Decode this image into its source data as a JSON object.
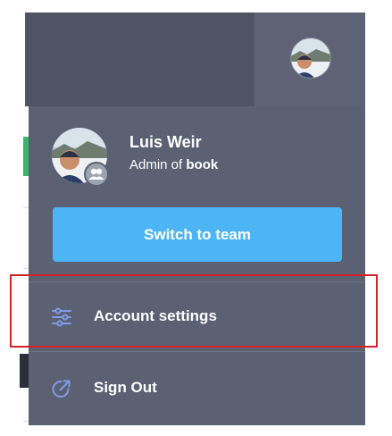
{
  "header": {
    "avatar_alt": "User avatar"
  },
  "profile": {
    "name": "Luis Weir",
    "role_prefix": "Admin of ",
    "team_name": "book"
  },
  "actions": {
    "switch_team_label": "Switch to team"
  },
  "menu": {
    "items": [
      {
        "label": "Account settings",
        "icon": "sliders-icon"
      },
      {
        "label": "Sign Out",
        "icon": "sign-out-icon"
      }
    ]
  },
  "colors": {
    "panel": "#5b6073",
    "header_dark": "#4f5363",
    "button": "#4db4f5",
    "icon_accent": "#7f9ce8",
    "highlight": "#d2232a"
  }
}
